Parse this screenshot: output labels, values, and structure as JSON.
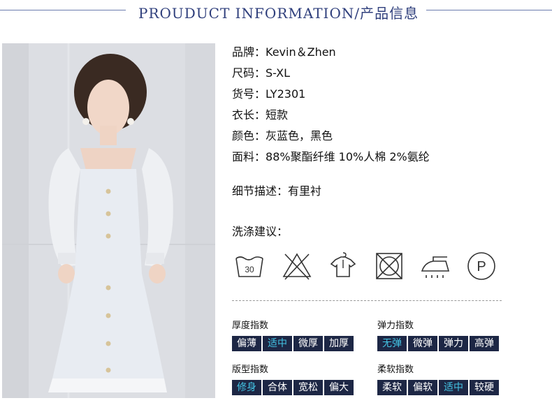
{
  "header": {
    "title": "PROUDUCT INFORMATION/产品信息"
  },
  "specs": [
    {
      "label": "品牌：",
      "value": "Kevin＆Zhen"
    },
    {
      "label": "尺码：",
      "value": "S-XL"
    },
    {
      "label": "货号：",
      "value": "LY2301"
    },
    {
      "label": "衣长：",
      "value": "短款"
    },
    {
      "label": "颜色：",
      "value": "灰蓝色，黑色"
    },
    {
      "label": "面料：",
      "value": "88%聚酯纤维  10%人棉 2%氨纶"
    }
  ],
  "detail": {
    "label": "细节描述：",
    "value": "有里衬"
  },
  "care": {
    "title": "洗涤建议：",
    "wash_temp": "30",
    "professional_mark": "P",
    "icons": [
      "wash-30-icon",
      "do-not-bleach-icon",
      "hang-dry-icon",
      "do-not-tumble-dry-icon",
      "iron-steam-icon",
      "professional-dry-clean-icon"
    ]
  },
  "indices": [
    {
      "title": "厚度指数",
      "options": [
        "偏薄",
        "适中",
        "微厚",
        "加厚"
      ],
      "selected": 1
    },
    {
      "title": "弹力指数",
      "options": [
        "无弹",
        "微弹",
        "弹力",
        "高弹"
      ],
      "selected": 0
    },
    {
      "title": "版型指数",
      "options": [
        "修身",
        "合体",
        "宽松",
        "偏大"
      ],
      "selected": 0
    },
    {
      "title": "柔软指数",
      "options": [
        "柔软",
        "偏软",
        "适中",
        "较硬"
      ],
      "selected": 2
    }
  ],
  "colors": {
    "title": "#2f3f7c",
    "chip_bg": "#1d2745",
    "chip_active_text": "#44c3e3",
    "chip_text": "#ffffff"
  }
}
